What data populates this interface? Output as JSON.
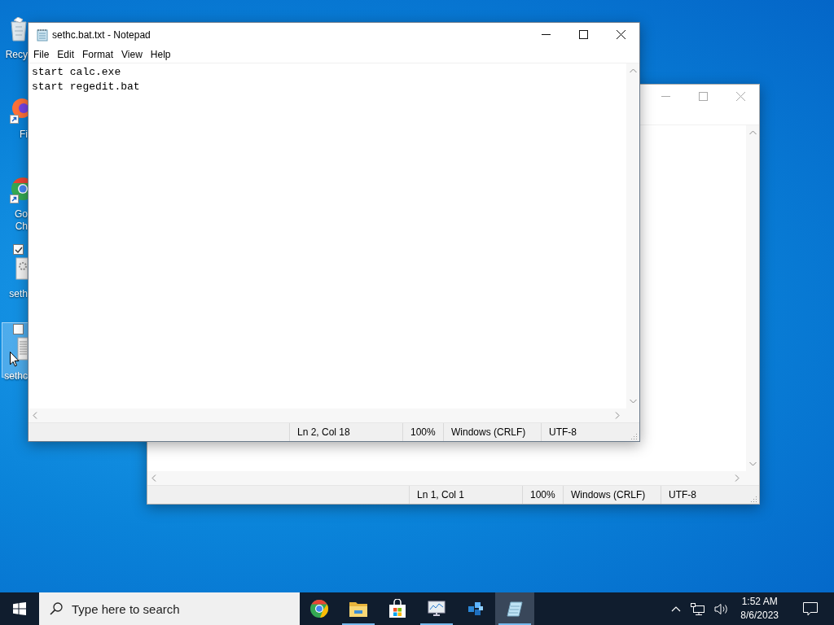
{
  "desktop": {
    "icons": [
      {
        "kind": "recycle-bin",
        "label_lines": [
          "Recy"
        ],
        "shortcut": false,
        "hovered": false,
        "selected": false
      },
      {
        "kind": "firefox",
        "label_lines": [
          "Fi"
        ],
        "shortcut": true,
        "hovered": false,
        "selected": false
      },
      {
        "kind": "chrome",
        "label_lines": [
          "Go",
          "Ch"
        ],
        "shortcut": true,
        "hovered": false,
        "selected": false
      },
      {
        "kind": "gear-file",
        "label_lines": [
          "seth"
        ],
        "shortcut": false,
        "hovered": false,
        "selected": true
      },
      {
        "kind": "text-file",
        "label_lines": [
          "sethc"
        ],
        "shortcut": false,
        "hovered": true,
        "selected": false
      }
    ]
  },
  "windows": [
    {
      "title": "sethc.bat.txt - Notepad",
      "active": true,
      "menu": [
        "File",
        "Edit",
        "Format",
        "View",
        "Help"
      ],
      "lines": [
        "start calc.exe",
        "start regedit.bat"
      ],
      "status": {
        "position": "Ln 2, Col 18",
        "zoom": "100%",
        "line_endings": "Windows (CRLF)",
        "encoding": "UTF-8"
      }
    },
    {
      "active": false,
      "status": {
        "position": "Ln 1, Col 1",
        "zoom": "100%",
        "line_endings": "Windows (CRLF)",
        "encoding": "UTF-8"
      }
    }
  ],
  "taskbar": {
    "search": {
      "placeholder": "Type here to search"
    },
    "apps": [
      {
        "kind": "chrome",
        "running": false,
        "active": false
      },
      {
        "kind": "folder",
        "running": true,
        "active": false
      },
      {
        "kind": "store",
        "running": false,
        "active": false
      },
      {
        "kind": "monitor",
        "running": true,
        "active": false
      },
      {
        "kind": "cubes",
        "running": false,
        "active": false
      },
      {
        "kind": "notepad",
        "running": true,
        "active": true
      }
    ],
    "clock": {
      "time": "1:52 AM",
      "date": "8/6/2023"
    }
  }
}
